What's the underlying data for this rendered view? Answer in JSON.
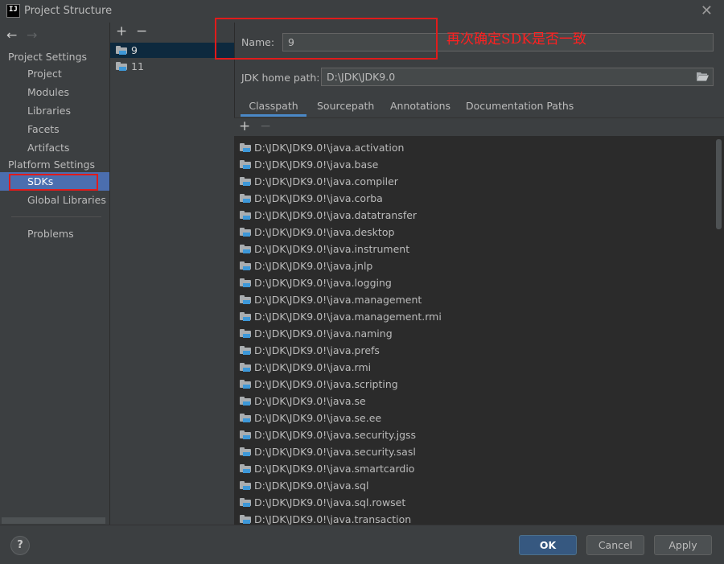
{
  "window": {
    "title": "Project Structure",
    "logo_text": "IJ",
    "close_glyph": "✕"
  },
  "nav": {
    "back_glyph": "←",
    "forward_glyph": "→",
    "project_settings_header": "Project Settings",
    "project_items": [
      "Project",
      "Modules",
      "Libraries",
      "Facets",
      "Artifacts"
    ],
    "platform_settings_header": "Platform Settings",
    "platform_items": [
      "SDKs",
      "Global Libraries"
    ],
    "problems": "Problems",
    "selected": "SDKs"
  },
  "sdk_list": {
    "add_glyph": "+",
    "remove_glyph": "−",
    "items": [
      "9",
      "11"
    ],
    "selected": "9"
  },
  "sdk_details": {
    "name_label": "Name:",
    "name_value": "9",
    "home_path_label": "JDK home path:",
    "home_path_value": "D:\\JDK\\JDK9.0",
    "tabs": [
      "Classpath",
      "Sourcepath",
      "Annotations",
      "Documentation Paths"
    ],
    "active_tab": "Classpath",
    "add_glyph": "+",
    "remove_glyph": "−",
    "classpath": [
      "D:\\JDK\\JDK9.0!\\java.activation",
      "D:\\JDK\\JDK9.0!\\java.base",
      "D:\\JDK\\JDK9.0!\\java.compiler",
      "D:\\JDK\\JDK9.0!\\java.corba",
      "D:\\JDK\\JDK9.0!\\java.datatransfer",
      "D:\\JDK\\JDK9.0!\\java.desktop",
      "D:\\JDK\\JDK9.0!\\java.instrument",
      "D:\\JDK\\JDK9.0!\\java.jnlp",
      "D:\\JDK\\JDK9.0!\\java.logging",
      "D:\\JDK\\JDK9.0!\\java.management",
      "D:\\JDK\\JDK9.0!\\java.management.rmi",
      "D:\\JDK\\JDK9.0!\\java.naming",
      "D:\\JDK\\JDK9.0!\\java.prefs",
      "D:\\JDK\\JDK9.0!\\java.rmi",
      "D:\\JDK\\JDK9.0!\\java.scripting",
      "D:\\JDK\\JDK9.0!\\java.se",
      "D:\\JDK\\JDK9.0!\\java.se.ee",
      "D:\\JDK\\JDK9.0!\\java.security.jgss",
      "D:\\JDK\\JDK9.0!\\java.security.sasl",
      "D:\\JDK\\JDK9.0!\\java.smartcardio",
      "D:\\JDK\\JDK9.0!\\java.sql",
      "D:\\JDK\\JDK9.0!\\java.sql.rowset",
      "D:\\JDK\\JDK9.0!\\java.transaction"
    ]
  },
  "annotation": {
    "text": "再次确定SDK是否一致",
    "color": "#e11b1b"
  },
  "footer": {
    "help_glyph": "?",
    "ok": "OK",
    "cancel": "Cancel",
    "apply": "Apply"
  },
  "colors": {
    "selection": "#4b6eaf",
    "list_selection": "#0d293e",
    "tab_underline": "#4a88c7",
    "default_button": "#365880"
  },
  "icons": {
    "sdk_item": "jdk-folder-icon",
    "classpath_item": "module-folder-icon",
    "browse": "open-folder-icon",
    "help": "help-icon"
  }
}
